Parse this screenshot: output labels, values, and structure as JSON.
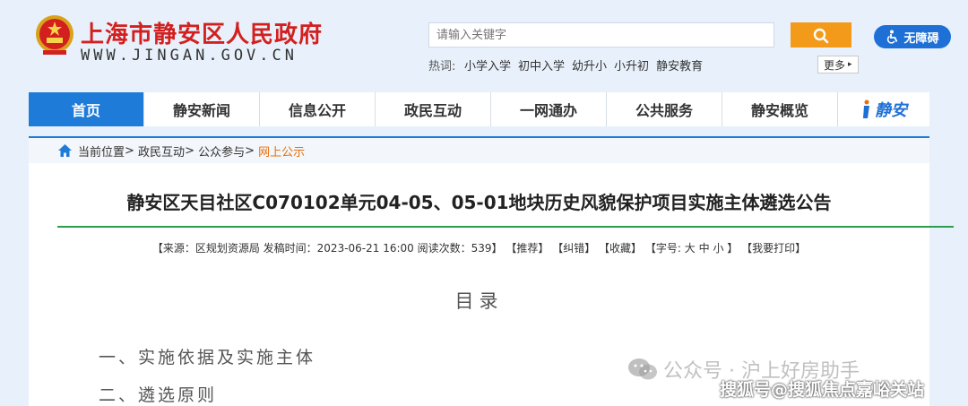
{
  "header": {
    "site_title": "上海市静安区人民政府",
    "site_url": "WWW.JINGAN.GOV.CN",
    "search_placeholder": "请输入关键字",
    "accessibility_label": "无障碍",
    "hot_label": "热词:",
    "hot_words": [
      "小学入学",
      "初中入学",
      "幼升小",
      "小升初",
      "静安教育"
    ],
    "more_label": "更多"
  },
  "nav": {
    "items": [
      "首页",
      "静安新闻",
      "信息公开",
      "政民互动",
      "一网通办",
      "公共服务",
      "静安概览"
    ],
    "logo_text": "静安"
  },
  "breadcrumb": {
    "prefix": "当前位置",
    "items": [
      "政民互动",
      "公众参与",
      "网上公示"
    ]
  },
  "article": {
    "title": "静安区天目社区C070102单元04-05、05-01地块历史风貌保护项目实施主体遴选公告",
    "meta": {
      "source": "【来源：区规划资源局  发稿时间：2023-06-21 16:00 阅读次数：539】",
      "recommend": "【推荐】",
      "correct": "【纠错】",
      "favorite": "【收藏】",
      "font_prefix": "【字号:",
      "font_large": "大",
      "font_medium": "中",
      "font_small": "小",
      "font_suffix": "】",
      "print": "【我要打印】"
    },
    "toc_title": "目录",
    "toc_items": [
      "一、实施依据及实施主体",
      "二、遴选原则"
    ]
  },
  "watermarks": {
    "line1": "公众号 · 沪上好房助手",
    "line2": "搜狐号@搜狐焦点嘉峪关站"
  }
}
